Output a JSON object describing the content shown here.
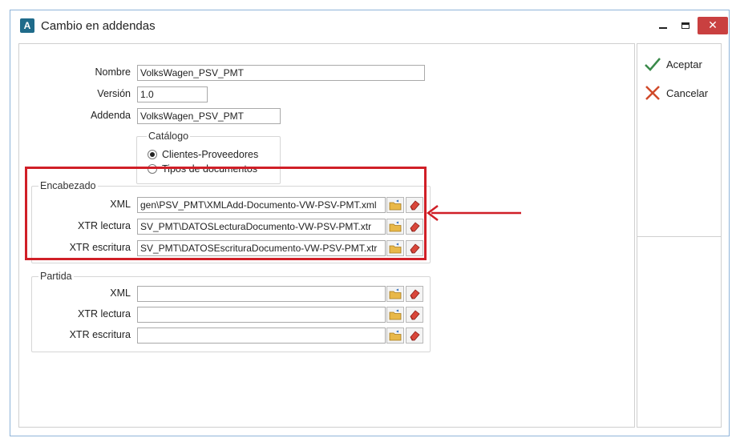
{
  "window": {
    "title": "Cambio en addendas",
    "app_icon_letter": "A",
    "close_glyph": "✕"
  },
  "form": {
    "nombre_label": "Nombre",
    "nombre_value": "VolksWagen_PSV_PMT",
    "version_label": "Versión",
    "version_value": "1.0",
    "addenda_label": "Addenda",
    "addenda_value": "VolksWagen_PSV_PMT"
  },
  "catalogo": {
    "title": "Catálogo",
    "options": [
      {
        "label": "Clientes-Proveedores",
        "selected": true
      },
      {
        "label": "Tipos de documentos",
        "selected": false
      }
    ]
  },
  "encabezado": {
    "title": "Encabezado",
    "rows": [
      {
        "label": "XML",
        "value": "gen\\PSV_PMT\\XMLAdd-Documento-VW-PSV-PMT.xml"
      },
      {
        "label": "XTR lectura",
        "value": "SV_PMT\\DATOSLecturaDocumento-VW-PSV-PMT.xtr"
      },
      {
        "label": "XTR escritura",
        "value": "SV_PMT\\DATOSEscrituraDocumento-VW-PSV-PMT.xtr"
      }
    ]
  },
  "partida": {
    "title": "Partida",
    "rows": [
      {
        "label": "XML",
        "value": ""
      },
      {
        "label": "XTR lectura",
        "value": ""
      },
      {
        "label": "XTR escritura",
        "value": ""
      }
    ]
  },
  "actions": {
    "accept_label": "Aceptar",
    "cancel_label": "Cancelar"
  },
  "colors": {
    "highlight": "#d01f27",
    "accept_check": "#3a8a4a",
    "cancel_x": "#d04a2a"
  }
}
